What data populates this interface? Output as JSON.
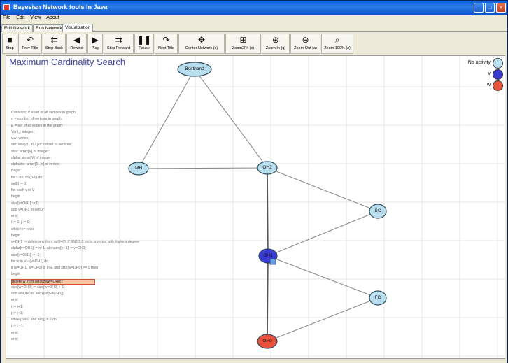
{
  "window": {
    "title": "Bayesian Network tools in Java",
    "controls": [
      "_",
      "□",
      "x"
    ]
  },
  "menu": [
    "File",
    "Edit",
    "View",
    "About"
  ],
  "tabs": [
    {
      "label": "Edit Network",
      "active": false
    },
    {
      "label": "Run Network",
      "active": false
    },
    {
      "label": "Visualization",
      "active": true
    }
  ],
  "toolbar": [
    {
      "label": "Stop",
      "icon": "stop-icon"
    },
    {
      "label": "Prev Title",
      "icon": "prev-title-icon"
    },
    {
      "label": "Step Back",
      "icon": "step-back-icon"
    },
    {
      "label": "Rewind",
      "icon": "rewind-icon"
    },
    {
      "label": "Play",
      "icon": "play-icon"
    },
    {
      "label": "Step Forward",
      "icon": "step-forward-icon"
    },
    {
      "label": "Pause",
      "icon": "pause-icon"
    },
    {
      "label": "Next Title",
      "icon": "next-title-icon"
    },
    {
      "label": "Center Network (c)",
      "icon": "center-network-icon"
    },
    {
      "label": "Zoom2Fit (x)",
      "icon": "zoom-fit-icon"
    },
    {
      "label": "Zoom In (q)",
      "icon": "zoom-in-icon"
    },
    {
      "label": "Zoom Out (a)",
      "icon": "zoom-out-icon"
    },
    {
      "label": "Zoom 100% (z)",
      "icon": "zoom-100-icon"
    }
  ],
  "panel": {
    "title": "Maximum Cardinality Search"
  },
  "legend": [
    {
      "label": "No activity",
      "color": "#b9dfef"
    },
    {
      "label": "v",
      "color": "#3b3bd6"
    },
    {
      "label": "w",
      "color": "#e8513c"
    }
  ],
  "algorithm": [
    "Constant: V = set of all vertices in graph;",
    "    n = number of vertices in graph;",
    "    E = set of all edges in the graph;",
    "Var i,j: integer;",
    "    v,w: vertex;",
    "    set: array[0..n-1] of subset of vertices;",
    "    size: array[V] of integer;",
    "    alpha: array[V] of integer;",
    "alphainv: array[1...n] of vertex;",
    "Begin",
    "  for i := 0 to (n-1) do",
    "    set[i] := 0;",
    "  for each v in V",
    "    begin",
    "      size[v=OH1] := 0;",
    "      add v=OH1 to set[0];",
    "    end;",
    "  i := 1; j := 0;",
    "  while i<= n do",
    "    begin",
    "      v=OH1 := delete any from set[j=0]; // BNJ 3.0 picks a vertex with highest degree",
    "      alpha[v=OH1] := n+1; alphainv[n+1] := v=OH1;",
    "      size[v=OH1] := -1;",
    "      for w in V - {v=OH1} do",
    "        if {v=OH1, w=OH0} is in E and size[w=OH0] >= 0 then",
    "          begin",
    "            delete w from set[size[w=OH0]];",
    "            size[w=OH0] := size[w=OH0] + 1;",
    "            add w=OH0 to set[size[w=OH0]];",
    "          end;",
    "      i := i+1;",
    "      j := j+1;",
    "      while j >= 0 and set[j] = 0 do",
    "        j := j - 1;",
    "    end;",
    "end;"
  ],
  "highlight_line": 26,
  "nodes": [
    {
      "id": "Besthand",
      "label": "Besthand",
      "state": "No activity"
    },
    {
      "id": "MH",
      "label": "MH",
      "state": "No activity"
    },
    {
      "id": "OH2",
      "label": "OH2",
      "state": "No activity"
    },
    {
      "id": "SC",
      "label": "SC",
      "state": "No activity"
    },
    {
      "id": "OH1",
      "label": "OH1",
      "state": "v"
    },
    {
      "id": "FC",
      "label": "FC",
      "state": "No activity"
    },
    {
      "id": "OH0",
      "label": "OH0",
      "state": "w"
    }
  ],
  "edges": [
    [
      "Besthand",
      "MH"
    ],
    [
      "Besthand",
      "OH2"
    ],
    [
      "MH",
      "OH2"
    ],
    [
      "OH2",
      "SC"
    ],
    [
      "OH2",
      "OH1"
    ],
    [
      "SC",
      "OH1"
    ],
    [
      "OH1",
      "FC"
    ],
    [
      "OH1",
      "OH0"
    ],
    [
      "FC",
      "OH0"
    ]
  ],
  "colors": {
    "no_activity": "#b9dfef",
    "v": "#3b3bd6",
    "w": "#e8513c",
    "title_blue": "#3e46a6"
  }
}
